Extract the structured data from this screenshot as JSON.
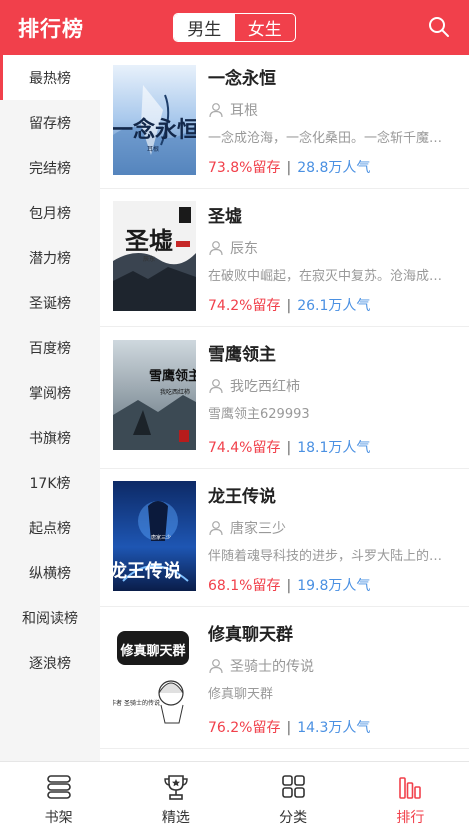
{
  "header": {
    "title": "排行榜",
    "tabs": [
      {
        "label": "男生",
        "active": true
      },
      {
        "label": "女生",
        "active": false
      }
    ],
    "search_icon": "search-icon",
    "accent_color": "#f1404b"
  },
  "sidebar": {
    "items": [
      {
        "label": "最热榜",
        "active": true
      },
      {
        "label": "留存榜"
      },
      {
        "label": "完结榜"
      },
      {
        "label": "包月榜"
      },
      {
        "label": "潜力榜"
      },
      {
        "label": "圣诞榜"
      },
      {
        "label": "百度榜"
      },
      {
        "label": "掌阅榜"
      },
      {
        "label": "书旗榜"
      },
      {
        "label": "17K榜"
      },
      {
        "label": "起点榜"
      },
      {
        "label": "纵横榜"
      },
      {
        "label": "和阅读榜"
      },
      {
        "label": "逐浪榜"
      }
    ]
  },
  "books": [
    {
      "title": "一念永恒",
      "author": "耳根",
      "desc": "一念成沧海，一念化桑田。一念斩千魔，一念诛万仙。",
      "retention": "73.8%留存",
      "separator": "|",
      "popularity": "28.8万人气",
      "cover_text": "一念永恒",
      "cover_sub": "耳根"
    },
    {
      "title": "圣墟",
      "author": "辰东",
      "desc": "在破败中崛起，在寂灭中复苏。沧海成尘，雷电枯竭",
      "retention": "74.2%留存",
      "separator": "|",
      "popularity": "26.1万人气",
      "cover_text": "圣墟",
      "cover_sub": "辰东"
    },
    {
      "title": "雪鹰领主",
      "author": "我吃西红柿",
      "desc": "雪鹰领主629993",
      "retention": "74.4%留存",
      "separator": "|",
      "popularity": "18.1万人气",
      "cover_text": "雪鹰领主",
      "cover_sub": "我吃西红柿"
    },
    {
      "title": "龙王传说",
      "author": "唐家三少",
      "desc": "伴随着魂导科技的进步，斗罗大陆上的人类征服了海洋",
      "retention": "68.1%留存",
      "separator": "|",
      "popularity": "19.8万人气",
      "cover_text": "龙王传说",
      "cover_sub": "唐家三少"
    },
    {
      "title": "修真聊天群",
      "author": "圣骑士的传说",
      "desc": "修真聊天群",
      "retention": "76.2%留存",
      "separator": "|",
      "popularity": "14.3万人气",
      "cover_text": "修真聊天群",
      "cover_sub": "作者 圣骑士的传说"
    }
  ],
  "bottom_nav": {
    "items": [
      {
        "label": "书架",
        "icon": "bookshelf-icon"
      },
      {
        "label": "精选",
        "icon": "trophy-icon"
      },
      {
        "label": "分类",
        "icon": "grid-icon"
      },
      {
        "label": "排行",
        "icon": "ranking-icon",
        "active": true
      }
    ]
  }
}
